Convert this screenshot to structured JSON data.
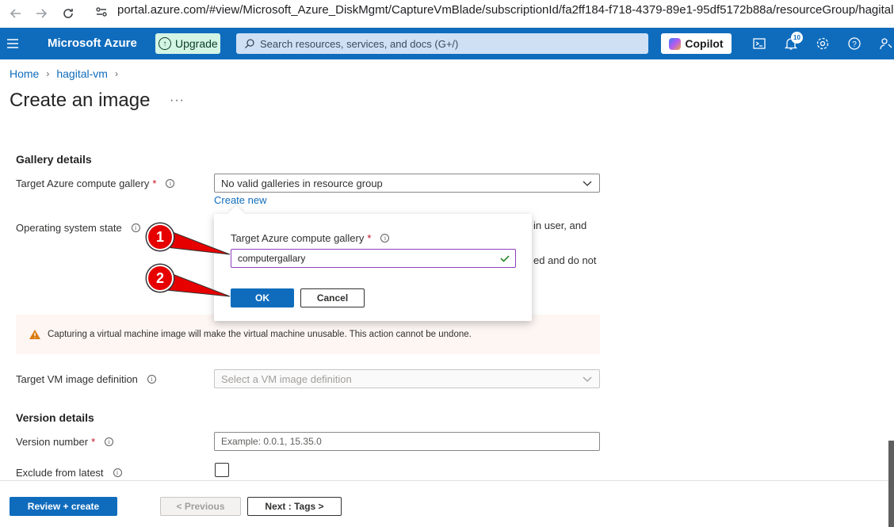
{
  "browser": {
    "url": "portal.azure.com/#view/Microsoft_Azure_DiskMgmt/CaptureVmBlade/subscriptionId/fa2ff184-f718-4379-89e1-95df5172b88a/resourceGroup/hagital-rg/loca..."
  },
  "topbar": {
    "brand": "Microsoft Azure",
    "upgrade_label": "Upgrade",
    "search_placeholder": "Search resources, services, and docs (G+/)",
    "copilot_label": "Copilot",
    "notification_count": "10"
  },
  "breadcrumb": {
    "items": [
      "Home",
      "hagital-vm"
    ]
  },
  "page": {
    "title": "Create an image",
    "more_label": "···"
  },
  "gallery": {
    "section_title": "Gallery details",
    "target_gallery_label": "Target Azure compute gallery",
    "target_gallery_value": "No valid galleries in resource group",
    "create_new_label": "Create new",
    "os_state_label": "Operating system state",
    "os_state_hidden_text_1": "in user, and",
    "os_state_hidden_text_2": "ed and do not"
  },
  "popup": {
    "label": "Target Azure compute gallery",
    "input_value": "computergallary",
    "ok_label": "OK",
    "cancel_label": "Cancel"
  },
  "warning": {
    "text": "Capturing a virtual machine image will make the virtual machine unusable. This action cannot be undone."
  },
  "image_definition": {
    "label": "Target VM image definition",
    "placeholder": "Select a VM image definition"
  },
  "version": {
    "section_title": "Version details",
    "number_label": "Version number",
    "number_placeholder": "Example: 0.0.1, 15.35.0",
    "exclude_label": "Exclude from latest"
  },
  "footer": {
    "review_label": "Review + create",
    "previous_label": "< Previous",
    "next_label": "Next : Tags >"
  },
  "callouts": [
    "1",
    "2"
  ],
  "colors": {
    "azure_blue": "#0f6cbd",
    "callout_red": "#e60000",
    "required_red": "#c50f1f"
  }
}
